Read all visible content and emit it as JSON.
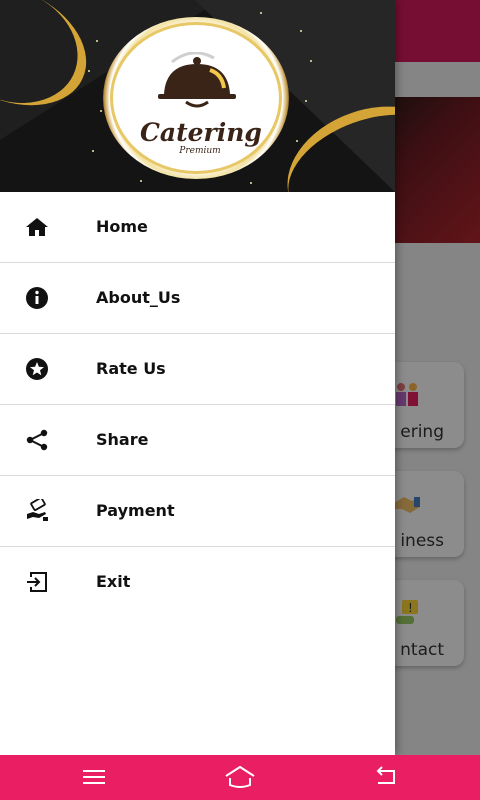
{
  "app": {
    "logo": {
      "title": "Catering",
      "subtitle": "Premium"
    }
  },
  "drawer": {
    "items": [
      {
        "label": "Home",
        "icon": "home-icon"
      },
      {
        "label": "About_Us",
        "icon": "info-icon"
      },
      {
        "label": "Rate Us",
        "icon": "star-icon"
      },
      {
        "label": "Share",
        "icon": "share-icon"
      },
      {
        "label": "Payment",
        "icon": "payment-icon"
      },
      {
        "label": "Exit",
        "icon": "exit-icon"
      }
    ]
  },
  "background": {
    "cards": [
      "ering",
      "iness",
      "ntact"
    ]
  },
  "navbar": {
    "buttons": [
      "menu-icon",
      "home-icon",
      "back-icon"
    ]
  },
  "colors": {
    "accent": "#e91e63",
    "toolbar": "#d81b60",
    "gold": "#d4a536"
  }
}
